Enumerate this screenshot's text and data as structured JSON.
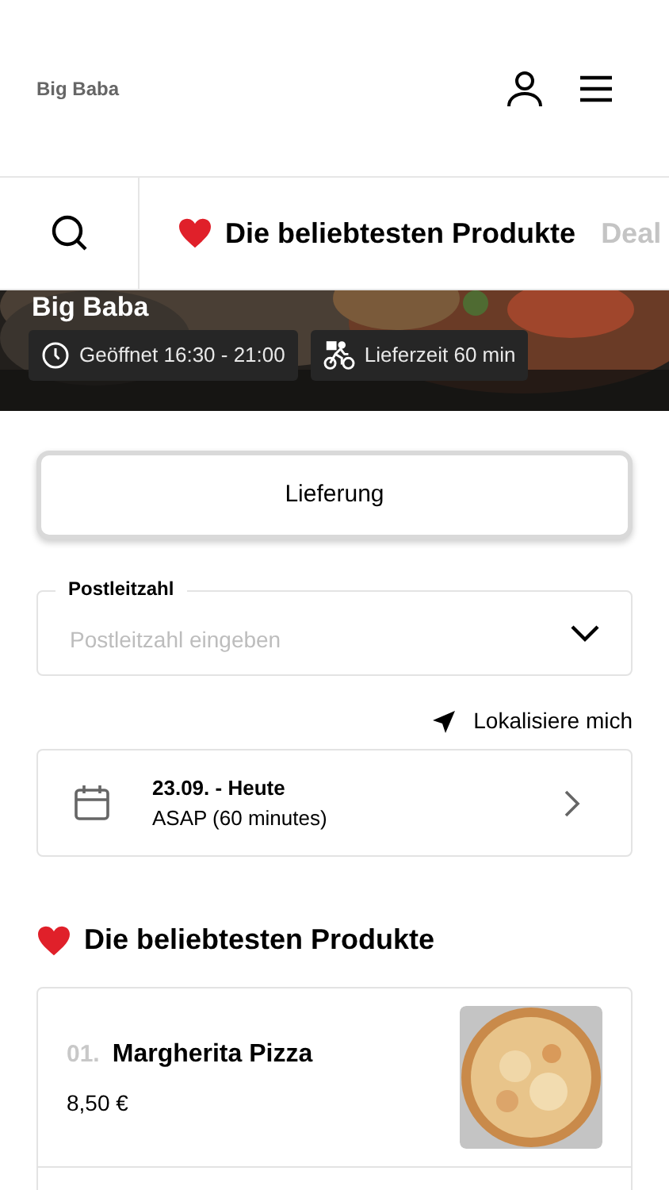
{
  "header": {
    "brand": "Big Baba"
  },
  "tabs": [
    {
      "label": "Die beliebtesten Produkte",
      "selected": true,
      "kind": "favorites"
    },
    {
      "label": "Deal",
      "selected": false,
      "kind": "plain"
    }
  ],
  "hero": {
    "title": "Big Baba",
    "chips": [
      {
        "kind": "clock",
        "text": "Geöffnet 16:30 - 21:00"
      },
      {
        "kind": "bike",
        "text": "Lieferzeit 60 min"
      }
    ]
  },
  "order_mode": {
    "label": "Lieferung",
    "selected": true
  },
  "postcode": {
    "label": "Postleitzahl",
    "placeholder": "Postleitzahl eingeben"
  },
  "locate_link": "Lokalisiere mich",
  "schedule": {
    "date": "23.09. - Heute",
    "time": "ASAP (60 minutes)"
  },
  "section": {
    "title": "Die beliebtesten Produkte"
  },
  "products": [
    {
      "index": "01.",
      "name": "Margherita Pizza",
      "price": "8,50 €"
    }
  ]
}
